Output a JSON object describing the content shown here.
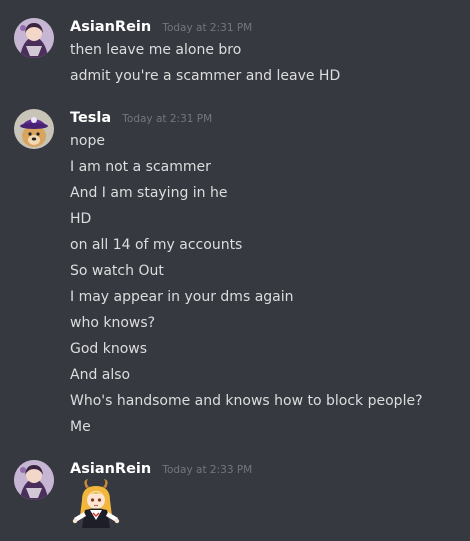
{
  "messages": [
    {
      "username": "AsianRein",
      "timestamp": "Today at 2:31 PM",
      "lines": [
        "then leave me alone bro",
        "admit you're a scammer and leave HD"
      ]
    },
    {
      "username": "Tesla",
      "timestamp": "Today at 2:31 PM",
      "lines": [
        "nope",
        "I am not a scammer",
        "And I am staying in he",
        "HD",
        "on all 14 of my accounts",
        "So watch Out",
        "I may appear in your dms again",
        "who knows?",
        "God knows",
        "And also",
        "Who's handsome and knows how to block people?",
        "Me"
      ]
    },
    {
      "username": "AsianRein",
      "timestamp": "Today at 2:33 PM",
      "lines": []
    }
  ]
}
